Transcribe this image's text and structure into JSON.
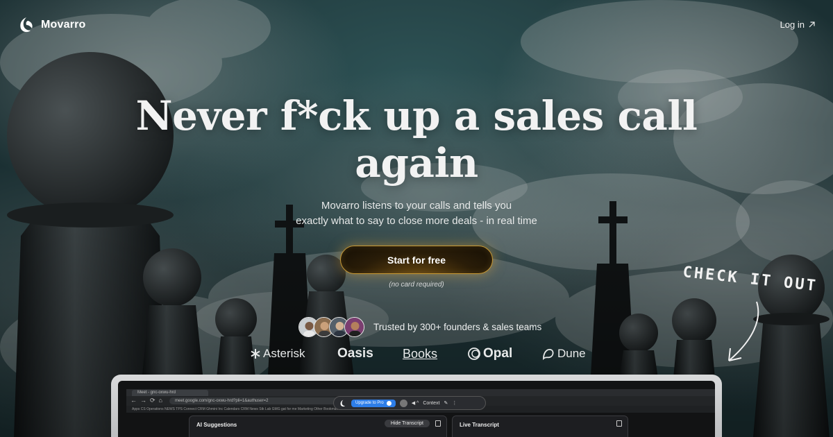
{
  "header": {
    "brand": "Movarro",
    "login_label": "Log in",
    "login_icon": "arrow-up-right-icon"
  },
  "hero": {
    "headline_line1": "Never f*ck up a sales call",
    "headline_line2": "again",
    "subtitle_line1": "Movarro listens to your calls and tells you",
    "subtitle_line2": "exactly what to say to close more deals - in real time",
    "cta_label": "Start for free",
    "cta_note": "(no card required)",
    "trusted_text": "Trusted by 300+ founders & sales teams",
    "customer_logos": [
      "Asterisk",
      "Oasis",
      "Books",
      "Opal",
      "Dune"
    ]
  },
  "callout": {
    "text": "CHECK IT OUT"
  },
  "app_preview": {
    "tab_title": "Meet - gnc-oxwu-hrd",
    "url": "meet.google.com/gnc-oxwu-hrd?pli=1&authuser=2",
    "upgrade_label": "Upgrade to Pro",
    "context_label": "Context",
    "ai_panel_title": "AI Suggestions",
    "hide_transcript_label": "Hide Transcript",
    "live_panel_title": "Live Transcript",
    "bookmarks": "Apps  CS  Operations  NEWS  TPS  Connect  CRM  Ghmini Inc  Calendars  CRM  News  Stk Lab  GMG  gat for me  Marketing  Other Bookmarks"
  },
  "colors": {
    "cta_border": "#c99a35",
    "cta_glow": "#d6a03c",
    "upgrade_blue": "#2e7ee8",
    "sky_teal": "#2e5356"
  }
}
